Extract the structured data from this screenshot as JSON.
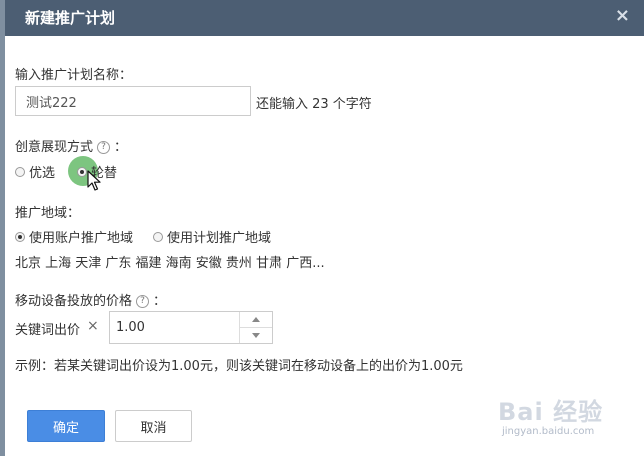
{
  "dialog": {
    "title": "新建推广计划",
    "close_glyph": "×"
  },
  "plan_name": {
    "label": "输入推广计划名称：",
    "value": "测试222",
    "hint": "还能输入 23 个字符"
  },
  "display_mode": {
    "label": "创意展现方式",
    "help_glyph": "?",
    "colon": "：",
    "options": [
      {
        "label": "优选",
        "checked": false
      },
      {
        "label": "轮替",
        "checked": true
      }
    ]
  },
  "region": {
    "label": "推广地域：",
    "options": [
      {
        "label": "使用账户推广地域",
        "checked": true
      },
      {
        "label": "使用计划推广地域",
        "checked": false
      }
    ],
    "summary": "北京 上海 天津 广东 福建 海南 安徽 贵州 甘肃 广西..."
  },
  "mobile_price": {
    "label": "移动设备投放的价格",
    "help_glyph": "?",
    "colon": "：",
    "bid_label": "关键词出价",
    "multiply": "×",
    "value": "1.00",
    "example": "示例：若某关键词出价设为1.00元，则该关键词在移动设备上的出价为1.00元"
  },
  "buttons": {
    "ok": "确定",
    "cancel": "取消"
  },
  "watermark": {
    "text": "Bai 经验",
    "sub": "jingyan.baidu.com"
  }
}
